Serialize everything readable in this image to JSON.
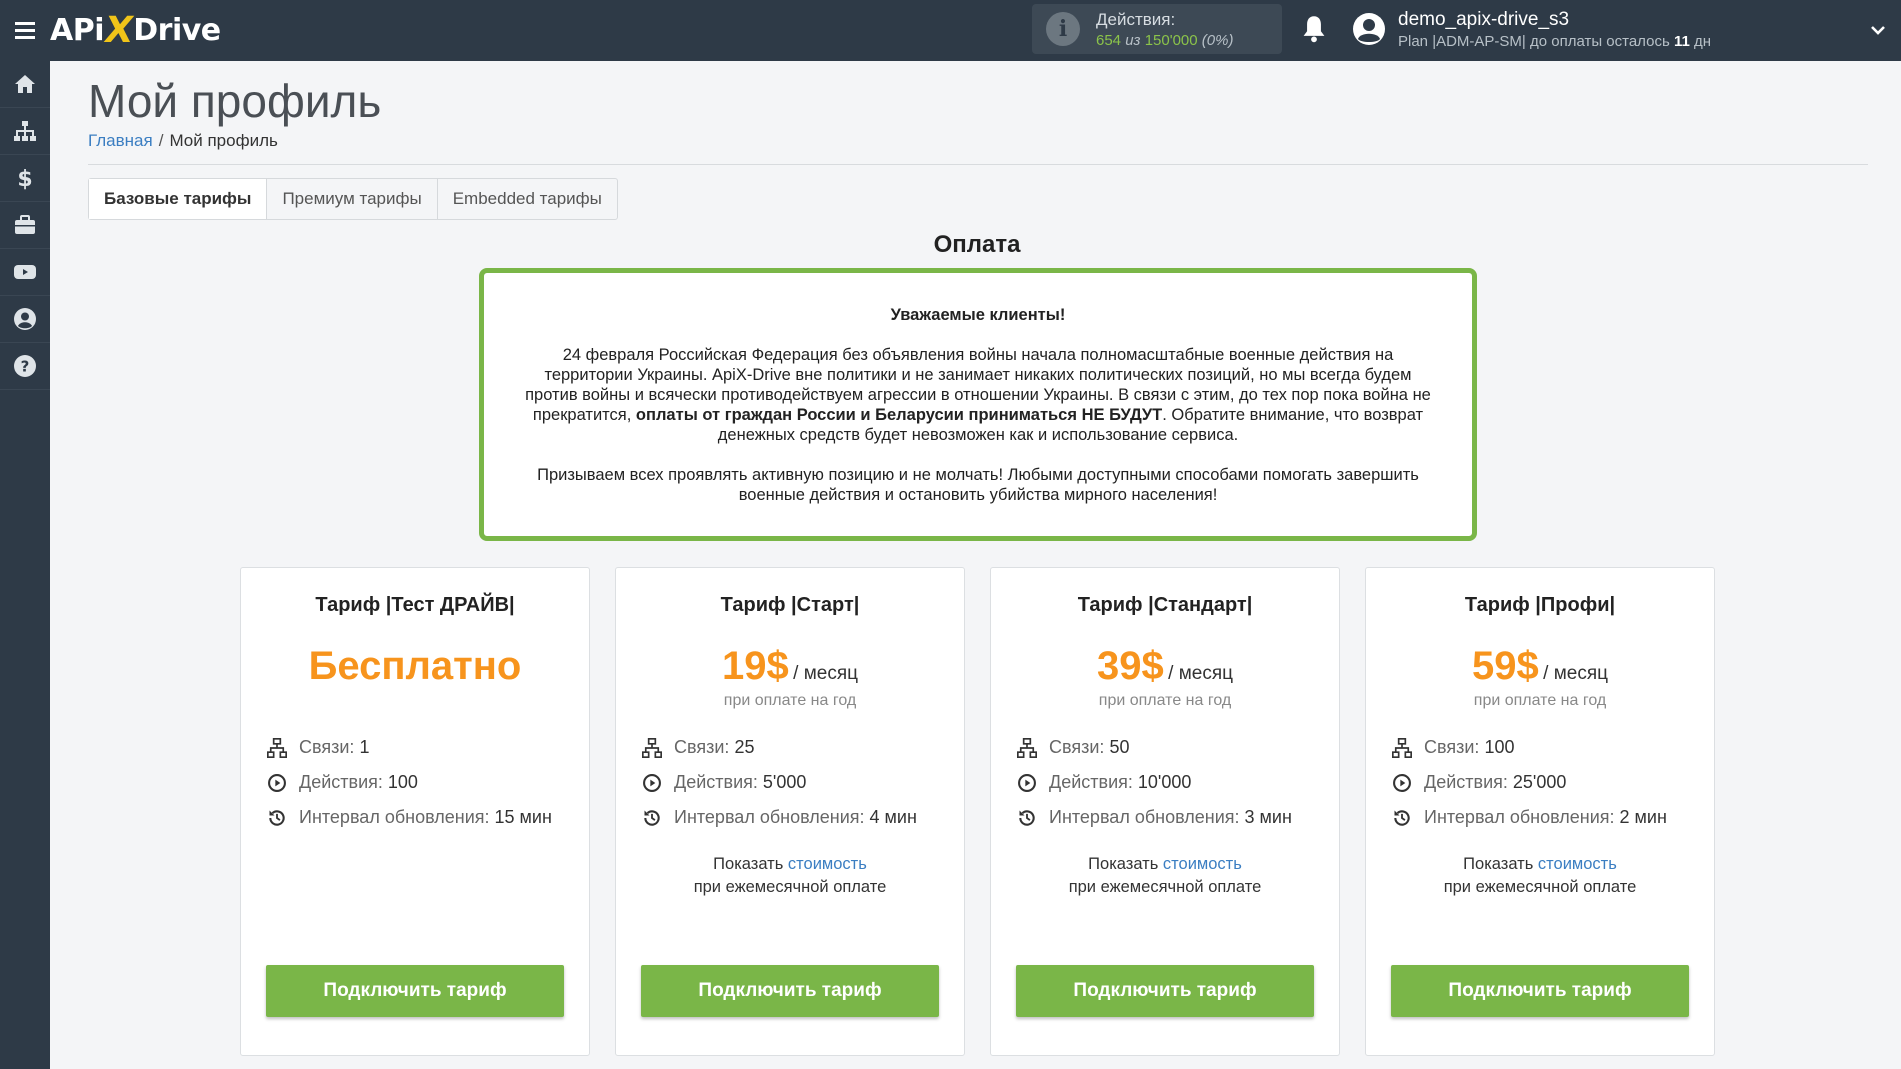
{
  "app": {
    "logo_part1": "APi",
    "logo_x": "X",
    "logo_part2": "Drive"
  },
  "topbar": {
    "actions_title": "Действия:",
    "actions_used": "654",
    "actions_of": " из ",
    "actions_total": "150'000",
    "actions_percent": " (0%)",
    "user_name": "demo_apix-drive_s3",
    "plan_prefix": "Plan |ADM-AP-SM| до оплаты осталось ",
    "plan_days": "11",
    "plan_suffix": " дн"
  },
  "sidebar": {
    "items": [
      "home-icon",
      "sitemap-icon",
      "dollar-icon",
      "briefcase-icon",
      "youtube-icon",
      "user-circle-icon",
      "question-icon"
    ]
  },
  "page": {
    "title": "Мой профиль",
    "breadcrumb_home": "Главная",
    "breadcrumb_sep": "/",
    "breadcrumb_current": "Мой профиль"
  },
  "tabs": [
    {
      "label": "Базовые тарифы",
      "active": true
    },
    {
      "label": "Премиум тарифы",
      "active": false
    },
    {
      "label": "Embedded тарифы",
      "active": false
    }
  ],
  "payment": {
    "title": "Оплата",
    "notice_title": "Уважаемые клиенты!",
    "notice_p1_a": "24 февраля Российская Федерация без объявления войны начала полномасштабные военные действия на территории Украины. ApiX-Drive вне политики и не занимает никаких политических позиций, но мы всегда будем против войны и всячески противодействуем агрессии в отношении Украины. В связи с этим, до тех пор пока война не прекратится, ",
    "notice_p1_bold": "оплаты от граждан России и Беларусии приниматься НЕ БУДУТ",
    "notice_p1_b": ". Обратите внимание, что возврат денежных средств будет невозможен как и использование сервиса.",
    "notice_p2": "Призываем всех проявлять активную позицию и не молчать! Любыми доступными способами помогать завершить военные действия и остановить убийства мирного населения!"
  },
  "plans": [
    {
      "title": "Тариф |Тест ДРАЙВ|",
      "price_free": "Бесплатно",
      "links_label": "Связи:",
      "links": "1",
      "actions_label": "Действия:",
      "actions": "100",
      "interval_label": "Интервал обновления:",
      "interval": "15 мин",
      "button": "Подключить тариф"
    },
    {
      "title": "Тариф |Старт|",
      "price": "19$",
      "per": "/ месяц",
      "year_note": "при оплате на год",
      "links_label": "Связи:",
      "links": "25",
      "actions_label": "Действия:",
      "actions": "5'000",
      "interval_label": "Интервал обновления:",
      "interval": "4 мин",
      "show_prefix": "Показать ",
      "show_link": "стоимость",
      "show_suffix": "при ежемесячной оплате",
      "button": "Подключить тариф"
    },
    {
      "title": "Тариф |Стандарт|",
      "price": "39$",
      "per": "/ месяц",
      "year_note": "при оплате на год",
      "links_label": "Связи:",
      "links": "50",
      "actions_label": "Действия:",
      "actions": "10'000",
      "interval_label": "Интервал обновления:",
      "interval": "3 мин",
      "show_prefix": "Показать ",
      "show_link": "стоимость",
      "show_suffix": "при ежемесячной оплате",
      "button": "Подключить тариф"
    },
    {
      "title": "Тариф |Профи|",
      "price": "59$",
      "per": "/ месяц",
      "year_note": "при оплате на год",
      "links_label": "Связи:",
      "links": "100",
      "actions_label": "Действия:",
      "actions": "25'000",
      "interval_label": "Интервал обновления:",
      "interval": "2 мин",
      "show_prefix": "Показать ",
      "show_link": "стоимость",
      "show_suffix": "при ежемесячной оплате",
      "button": "Подключить тариф"
    }
  ],
  "colors": {
    "topbar": "#2e3a47",
    "accent_green": "#7ab648",
    "price_orange": "#f7941d",
    "link_blue": "#3b7ec2"
  }
}
